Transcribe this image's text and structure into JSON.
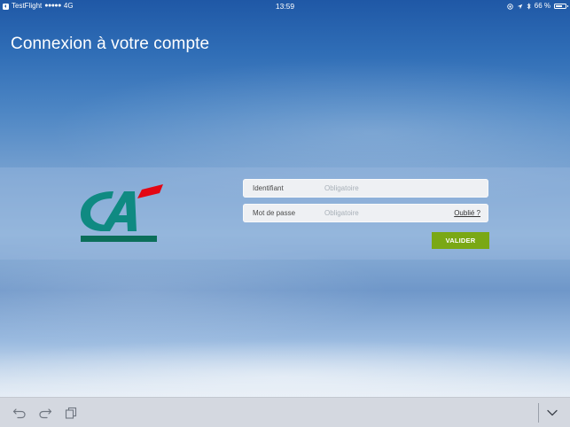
{
  "status_bar": {
    "carrier_app": "TestFlight",
    "signal": "●●●●●",
    "network": "4G",
    "time": "13:59",
    "battery_percent": "66 %"
  },
  "page": {
    "title": "Connexion à votre compte"
  },
  "brand": {
    "logo_text": "CA",
    "colors": {
      "teal": "#0f8a82",
      "dark_green": "#0b6f5a",
      "red": "#e30613",
      "submit_green": "#7aa815"
    }
  },
  "login_form": {
    "id_field": {
      "label": "Identifiant",
      "placeholder": "Obligatoire",
      "value": ""
    },
    "password_field": {
      "label": "Mot de passe",
      "placeholder": "Obligatoire",
      "value": ""
    },
    "forgot_link": "Oublié ?",
    "submit_label": "VALIDER"
  },
  "toolbar": {
    "icons": [
      "undo-icon",
      "redo-icon",
      "clipboard-icon",
      "chevron-down-icon"
    ]
  }
}
